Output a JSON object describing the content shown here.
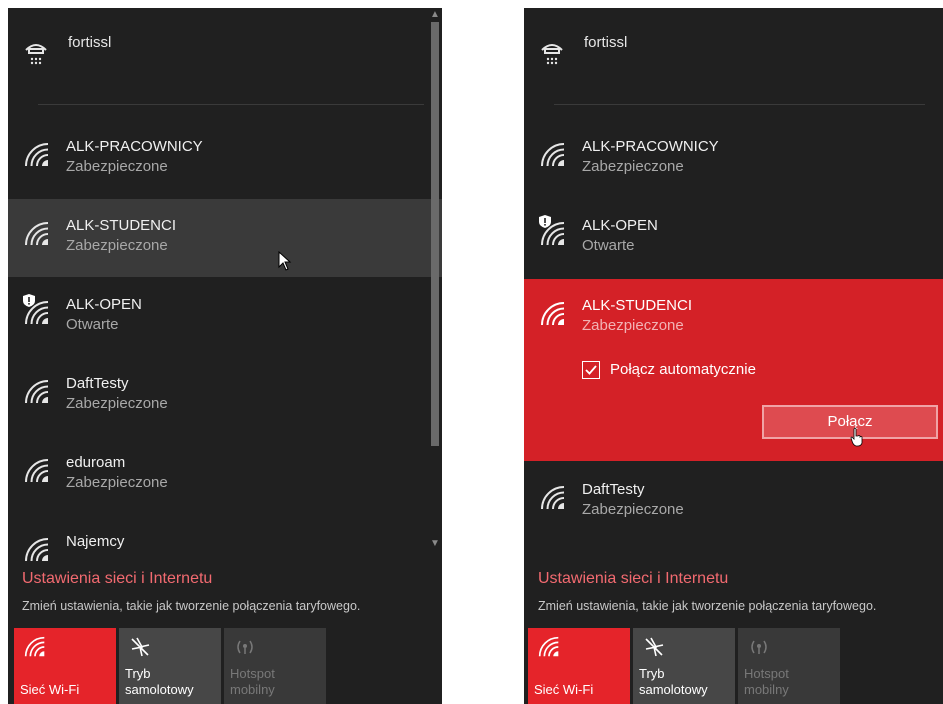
{
  "left": {
    "vpn": {
      "name": "fortissl",
      "icon": "vpn-icon"
    },
    "networks": [
      {
        "name": "ALK-PRACOWNICY",
        "status": "Zabezpieczone",
        "icon": "wifi-icon"
      },
      {
        "name": "ALK-STUDENCI",
        "status": "Zabezpieczone",
        "icon": "wifi-icon",
        "hovered": true
      },
      {
        "name": "ALK-OPEN",
        "status": "Otwarte",
        "icon": "wifi-open-warning-icon"
      },
      {
        "name": "DaftTesty",
        "status": "Zabezpieczone",
        "icon": "wifi-icon"
      },
      {
        "name": "eduroam",
        "status": "Zabezpieczone",
        "icon": "wifi-icon"
      },
      {
        "name": "Najemcy",
        "status": "",
        "icon": "wifi-icon"
      }
    ],
    "settings_link": "Ustawienia sieci i Internetu",
    "settings_desc": "Zmień ustawienia, takie jak tworzenie połączenia taryfowego.",
    "tiles": {
      "wifi": "Sieć Wi-Fi",
      "airplane_1": "Tryb",
      "airplane_2": "samolotowy",
      "hotspot_1": "Hotspot",
      "hotspot_2": "mobilny"
    }
  },
  "right": {
    "vpn": {
      "name": "fortissl",
      "icon": "vpn-icon"
    },
    "networks": [
      {
        "name": "ALK-PRACOWNICY",
        "status": "Zabezpieczone",
        "icon": "wifi-icon"
      },
      {
        "name": "ALK-OPEN",
        "status": "Otwarte",
        "icon": "wifi-open-warning-icon"
      }
    ],
    "expanded": {
      "name": "ALK-STUDENCI",
      "status": "Zabezpieczone",
      "auto_connect_label": "Połącz automatycznie",
      "auto_connect_checked": true,
      "connect_label": "Połącz"
    },
    "after": {
      "name": "DaftTesty",
      "status": "Zabezpieczone",
      "icon": "wifi-icon"
    },
    "settings_link": "Ustawienia sieci i Internetu",
    "settings_desc": "Zmień ustawienia, takie jak tworzenie połączenia taryfowego.",
    "tiles": {
      "wifi": "Sieć Wi-Fi",
      "airplane_1": "Tryb",
      "airplane_2": "samolotowy",
      "hotspot_1": "Hotspot",
      "hotspot_2": "mobilny"
    }
  },
  "colors": {
    "accent": "#e5242a",
    "expanded_bg": "#d42127",
    "panel_bg": "#202020",
    "settings_link": "#f26a70"
  }
}
